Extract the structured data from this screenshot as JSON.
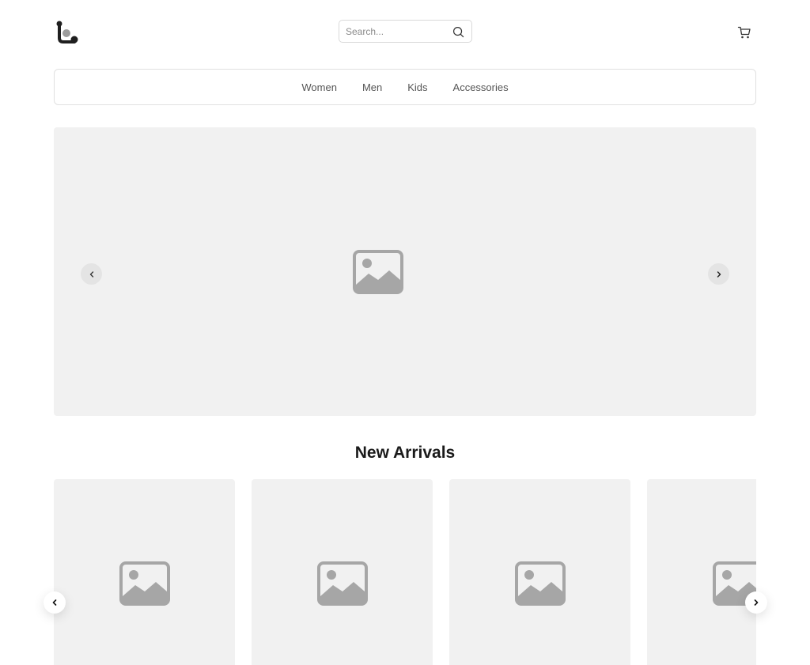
{
  "header": {
    "logo_icon": "brand-logo-icon",
    "search": {
      "placeholder": "Search...",
      "value": "",
      "icon": "search-icon"
    },
    "cart_icon": "cart-icon"
  },
  "nav": {
    "items": [
      {
        "label": "Women"
      },
      {
        "label": "Men"
      },
      {
        "label": "Kids"
      },
      {
        "label": "Accessories"
      }
    ]
  },
  "hero": {
    "image_icon": "image-placeholder-icon",
    "prev_icon": "chevron-left-icon",
    "next_icon": "chevron-right-icon"
  },
  "new_arrivals": {
    "title": "New Arrivals",
    "products": [
      {
        "image_icon": "image-placeholder-icon"
      },
      {
        "image_icon": "image-placeholder-icon"
      },
      {
        "image_icon": "image-placeholder-icon"
      },
      {
        "image_icon": "image-placeholder-icon"
      }
    ]
  },
  "colors": {
    "placeholder_bg": "#f1f1f1",
    "placeholder_icon": "#a6a6a6",
    "border": "#e0e0e0",
    "text_dark": "#1a1a1a",
    "nav_text": "#555555"
  }
}
